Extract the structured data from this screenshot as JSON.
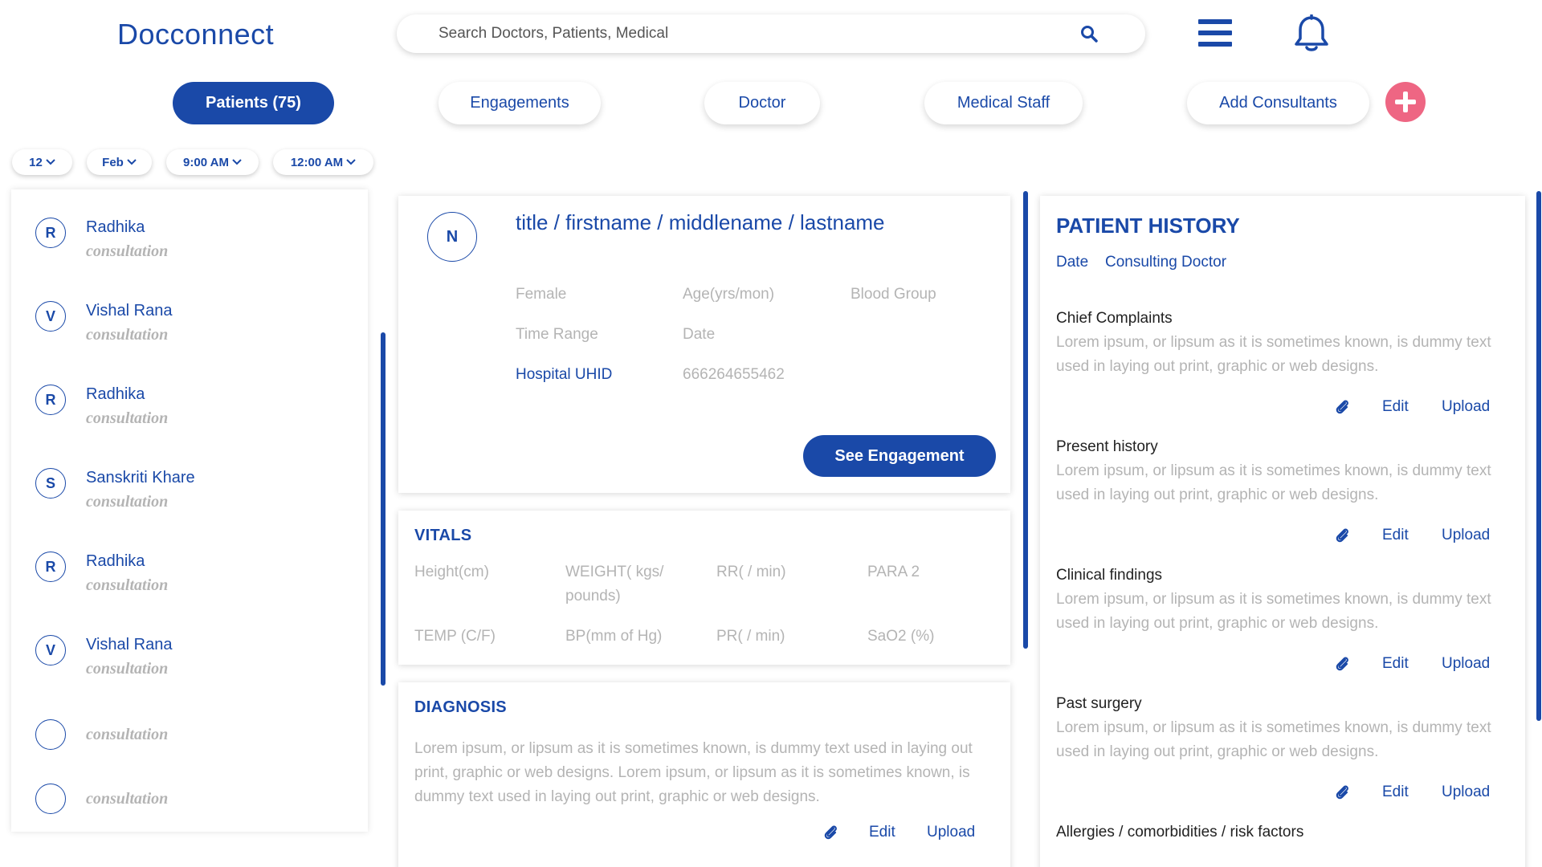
{
  "app": {
    "brand": "Docconnect"
  },
  "search": {
    "placeholder": "Search Doctors, Patients, Medical"
  },
  "tabs": [
    {
      "label": "Patients (75)",
      "active": true
    },
    {
      "label": "Engagements"
    },
    {
      "label": "Doctor"
    },
    {
      "label": "Medical Staff"
    },
    {
      "label": "Add Consultants"
    }
  ],
  "filters": {
    "day": "12",
    "month": "Feb",
    "from_time": "9:00 AM",
    "to_time": "12:00 AM"
  },
  "patients": [
    {
      "initial": "R",
      "name": "Radhika",
      "type": "consultation"
    },
    {
      "initial": "V",
      "name": "Vishal Rana",
      "type": "consultation"
    },
    {
      "initial": "R",
      "name": "Radhika",
      "type": "consultation"
    },
    {
      "initial": "S",
      "name": "Sanskriti Khare",
      "type": "consultation"
    },
    {
      "initial": "R",
      "name": "Radhika",
      "type": "consultation"
    },
    {
      "initial": "V",
      "name": "Vishal Rana",
      "type": "consultation"
    },
    {
      "initial": "",
      "name": "",
      "type": "consultation"
    },
    {
      "initial": "",
      "name": "",
      "type": "consultation"
    }
  ],
  "profile": {
    "initial": "N",
    "title": "title / firstname / middlename / lastname",
    "gender": "Female",
    "age_label": "Age(yrs/mon)",
    "blood_group_label": "Blood Group",
    "time_range_label": "Time Range",
    "date_label": "Date",
    "uhid_label": "Hospital UHID",
    "uhid_value": "666264655462",
    "see_engagement": "See Engagement"
  },
  "vitals": {
    "title": "VITALS",
    "height": "Height(cm)",
    "weight_line1": "WEIGHT( kgs/",
    "weight_line2": "pounds)",
    "rr": "RR( / min)",
    "para": "PARA 2",
    "temp": "TEMP (C/F)",
    "bp": "BP(mm of Hg)",
    "pr": "PR( / min)",
    "sao2": "SaO2 (%)"
  },
  "diagnosis": {
    "title": "DIAGNOSIS",
    "text": "Lorem ipsum, or lipsum as it is sometimes known, is dummy text used in laying out print, graphic or web designs. Lorem ipsum, or lipsum as it is sometimes known, is dummy text used in laying out print, graphic or web designs.",
    "edit": "Edit",
    "upload": "Upload"
  },
  "history": {
    "title": "PATIENT HISTORY",
    "date_link": "Date",
    "doctor_link": "Consulting Doctor",
    "edit": "Edit",
    "upload": "Upload",
    "sections": [
      {
        "heading": "Chief Complaints",
        "text": "Lorem ipsum, or lipsum as it is sometimes known, is dummy text used in laying out print, graphic or web designs."
      },
      {
        "heading": "Present history",
        "text": "Lorem ipsum, or lipsum as it is sometimes known, is dummy text used in laying out print, graphic or web designs."
      },
      {
        "heading": "Clinical findings",
        "text": "Lorem ipsum, or lipsum as it is sometimes known, is dummy text used in laying out print, graphic or web designs."
      },
      {
        "heading": "Past surgery",
        "text": "Lorem ipsum, or lipsum as it is sometimes known, is dummy text used in laying out print, graphic or web designs."
      },
      {
        "heading": "Allergies / comorbidities / risk factors",
        "text": ""
      }
    ]
  },
  "colors": {
    "primary": "#1a49a8",
    "accent": "#ee6683",
    "muted": "#b4b4b4"
  }
}
